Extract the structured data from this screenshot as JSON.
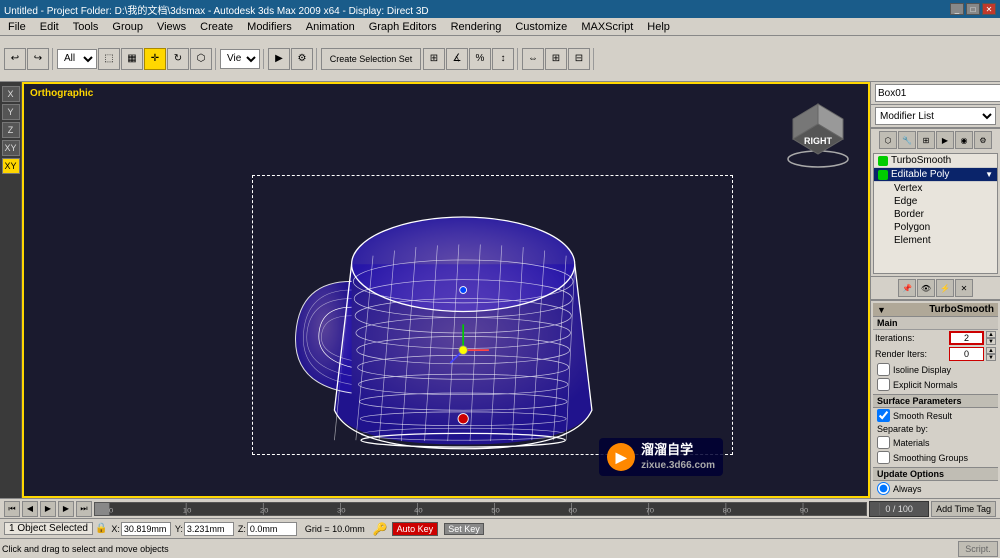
{
  "titleBar": {
    "title": "Untitled - Project Folder: D:\\我的文档\\3dsmax - Autodesk 3ds Max 2009 x64 - Display: Direct 3D",
    "winControls": [
      "_",
      "□",
      "✕"
    ]
  },
  "menuBar": {
    "items": [
      "File",
      "Edit",
      "Tools",
      "Group",
      "Views",
      "Create",
      "Modifiers",
      "Animation",
      "Graph Editors",
      "Rendering",
      "Customize",
      "MAXScript",
      "Help"
    ]
  },
  "toolbar": {
    "selectDropdown": "All",
    "viewDropdown": "View"
  },
  "viewport": {
    "label": "Orthographic",
    "gizmoLabel": "RIGHT"
  },
  "rightPanel": {
    "objectName": "Box01",
    "colorSwatch": "#4444cc",
    "modifierList": "Modifier List",
    "modifiers": [
      {
        "name": "TurboSmooth",
        "selected": false,
        "hasLight": true,
        "lightOn": true
      },
      {
        "name": "Editable Poly",
        "selected": true,
        "hasLight": true,
        "lightOn": true,
        "expanded": true
      },
      {
        "name": "Vertex",
        "sub": true
      },
      {
        "name": "Edge",
        "sub": true
      },
      {
        "name": "Border",
        "sub": true
      },
      {
        "name": "Polygon",
        "sub": true
      },
      {
        "name": "Element",
        "sub": true
      }
    ]
  },
  "panelIcons": {
    "icons": [
      "⬡",
      "🔧",
      "💡",
      "📷",
      "🌐",
      "🔲"
    ]
  },
  "turboSmooth": {
    "header": "TurboSmooth",
    "mainLabel": "Main",
    "iterationsLabel": "Iterations:",
    "iterationsValue": "2",
    "renderItersLabel": "Render Iters:",
    "renderItersValue": "0",
    "isolineDisplay": "Isoline Display",
    "explicitNormals": "Explicit Normals",
    "surfaceParamsHeader": "Surface Parameters",
    "separateByLabel": "Separate by:",
    "smoothResult": "Smooth Result",
    "materialsLabel": "Materials",
    "smoothingGroupsLabel": "Smoothing Groups",
    "updateOptionsHeader": "Update Options",
    "alwaysLabel": "Always"
  },
  "timeline": {
    "frameCounter": "0 / 100",
    "timeTag": "Add Time Tag"
  },
  "statusBar": {
    "selectedText": "1 Object Selected",
    "clickDragText": "Click and drag to select and move objects",
    "xLabel": "X:",
    "xValue": "30.819mm",
    "yLabel": "Y:",
    "yValue": "3.231mm",
    "zLabel": "Z:",
    "zValue": "0.0mm",
    "gridLabel": "Grid = 10.0mm",
    "autoKeyLabel": "Auto Key",
    "setKeyLabel": "Set Key"
  },
  "watermark": {
    "logoText": "▶",
    "line1": "溜溜自学",
    "line2": "zixue.3d66.com"
  }
}
